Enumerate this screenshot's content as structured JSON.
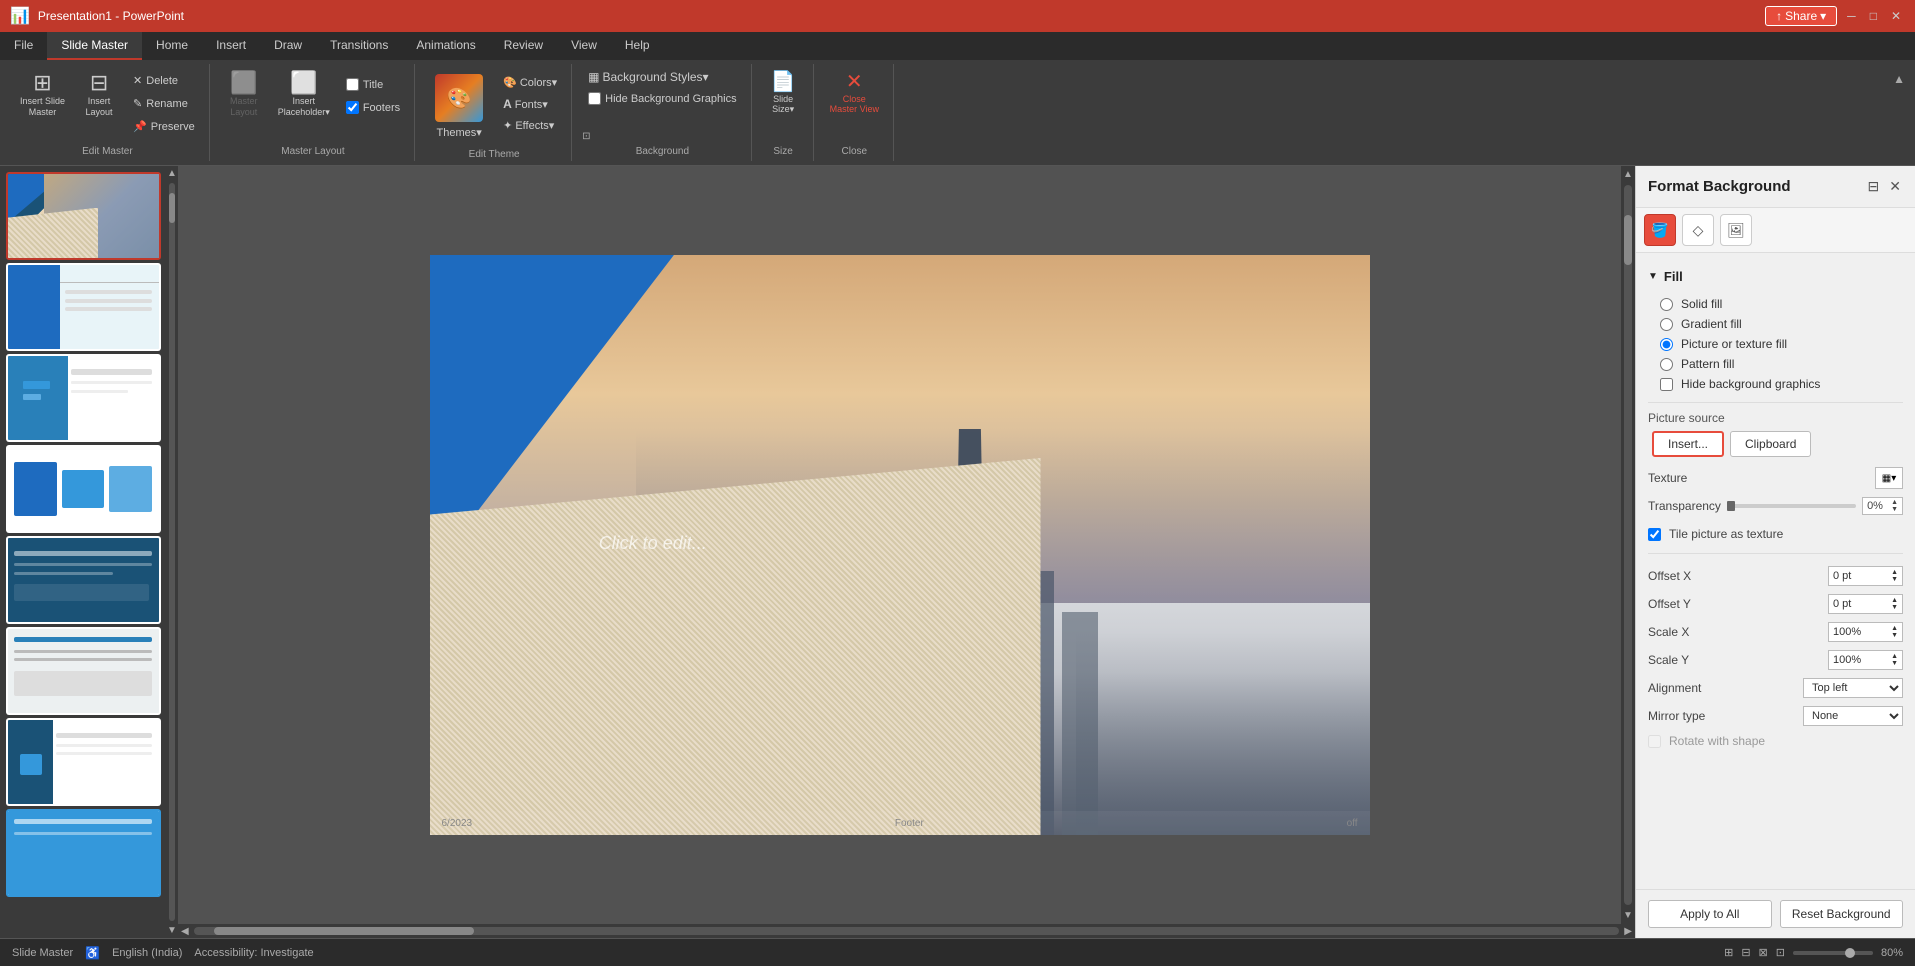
{
  "titleBar": {
    "appName": "PowerPoint",
    "fileName": "Presentation1 - PowerPoint",
    "shareBtn": "Share",
    "windowControls": [
      "─",
      "□",
      "✕"
    ]
  },
  "ribbonTabs": [
    {
      "label": "File",
      "active": false
    },
    {
      "label": "Slide Master",
      "active": true
    },
    {
      "label": "Home",
      "active": false
    },
    {
      "label": "Insert",
      "active": false
    },
    {
      "label": "Draw",
      "active": false
    },
    {
      "label": "Transitions",
      "active": false
    },
    {
      "label": "Animations",
      "active": false
    },
    {
      "label": "Review",
      "active": false
    },
    {
      "label": "View",
      "active": false
    },
    {
      "label": "Help",
      "active": false
    }
  ],
  "ribbon": {
    "groups": [
      {
        "label": "Edit Master",
        "buttons": [
          {
            "label": "Insert Slide\nMaster",
            "icon": "⊞"
          },
          {
            "label": "Insert\nLayout",
            "icon": "⊟"
          }
        ],
        "smallButtons": [
          {
            "label": "Delete",
            "icon": "✕"
          },
          {
            "label": "Rename",
            "icon": "✎"
          },
          {
            "label": "Preserve",
            "icon": "📌"
          }
        ]
      },
      {
        "label": "Master Layout",
        "buttons": [
          {
            "label": "Master\nLayout",
            "icon": "⬜",
            "disabled": true
          },
          {
            "label": "Insert\nPlaceholder",
            "icon": "⬜"
          }
        ],
        "checkboxes": [
          {
            "label": "Title",
            "checked": false
          },
          {
            "label": "Footers",
            "checked": true
          }
        ]
      },
      {
        "label": "Edit Theme",
        "themes": {
          "label": "Themes",
          "icon": "🎨"
        },
        "dropdowns": [
          {
            "label": "Colors",
            "icon": "🎨"
          },
          {
            "label": "Fonts",
            "icon": "A"
          },
          {
            "label": "Effects",
            "icon": "✦"
          }
        ]
      },
      {
        "label": "Background",
        "dropdowns": [
          {
            "label": "Background Styles",
            "icon": "▦"
          }
        ],
        "checkboxes": [
          {
            "label": "Hide Background Graphics",
            "checked": false
          }
        ],
        "formatBtn": {
          "label": "⊞",
          "icon": "⬛"
        }
      },
      {
        "label": "Size",
        "buttons": [
          {
            "label": "Slide\nSize",
            "icon": "📄"
          }
        ]
      },
      {
        "label": "Close",
        "buttons": [
          {
            "label": "Close\nMaster View",
            "icon": "✕",
            "red": true
          }
        ]
      }
    ]
  },
  "formatPanel": {
    "title": "Format Background",
    "tabs": [
      {
        "icon": "🪣",
        "label": "fill-tab",
        "active": true
      },
      {
        "icon": "◇",
        "label": "shape-tab",
        "active": false
      },
      {
        "icon": "🖼",
        "label": "image-tab",
        "active": false
      }
    ],
    "sections": {
      "fill": {
        "label": "Fill",
        "expanded": true,
        "options": [
          {
            "label": "Solid fill",
            "selected": false
          },
          {
            "label": "Gradient fill",
            "selected": false
          },
          {
            "label": "Picture or texture fill",
            "selected": true
          },
          {
            "label": "Pattern fill",
            "selected": false
          },
          {
            "label": "Hide background graphics",
            "selected": false,
            "type": "checkbox"
          }
        ],
        "pictureSource": {
          "label": "Picture source",
          "insertBtn": "Insert...",
          "clipboardBtn": "Clipboard"
        },
        "texture": {
          "label": "Texture",
          "btnIcon": "▦"
        },
        "transparency": {
          "label": "Transparency",
          "value": "0%",
          "sliderMin": 0,
          "sliderMax": 100,
          "sliderValue": 0
        },
        "tileCheckbox": {
          "label": "Tile picture as texture",
          "checked": true
        },
        "offsetX": {
          "label": "Offset X",
          "value": "0 pt"
        },
        "offsetY": {
          "label": "Offset Y",
          "value": "0 pt"
        },
        "scaleX": {
          "label": "Scale X",
          "value": "100%"
        },
        "scaleY": {
          "label": "Scale Y",
          "value": "100%"
        },
        "alignment": {
          "label": "Alignment",
          "value": "Top left"
        },
        "mirrorType": {
          "label": "Mirror type",
          "value": "None"
        },
        "rotateWithShape": {
          "label": "Rotate with shape",
          "checked": false,
          "disabled": true
        }
      }
    },
    "footer": {
      "applyBtn": "Apply to All",
      "resetBtn": "Reset Background"
    }
  },
  "slides": [
    {
      "id": 1,
      "selected": true,
      "thumb": "thumb-1"
    },
    {
      "id": 2,
      "selected": false,
      "thumb": "thumb-2"
    },
    {
      "id": 3,
      "selected": false,
      "thumb": "thumb-3"
    },
    {
      "id": 4,
      "selected": false,
      "thumb": "thumb-4"
    },
    {
      "id": 5,
      "selected": false,
      "thumb": "thumb-5"
    },
    {
      "id": 6,
      "selected": false,
      "thumb": "thumb-6"
    },
    {
      "id": 7,
      "selected": false,
      "thumb": "thumb-7"
    },
    {
      "id": 8,
      "selected": false,
      "thumb": "thumb-8"
    }
  ],
  "statusBar": {
    "mode": "Slide Master",
    "language": "English (India)",
    "accessibility": "Accessibility: Investigate",
    "zoom": "80%",
    "viewIcons": [
      "⊞",
      "⊟",
      "⊠",
      "⊡"
    ]
  },
  "canvas": {
    "slideText": "Click to edit...",
    "footer": {
      "left": "6/2023",
      "center": "Footer",
      "right": "off"
    }
  }
}
